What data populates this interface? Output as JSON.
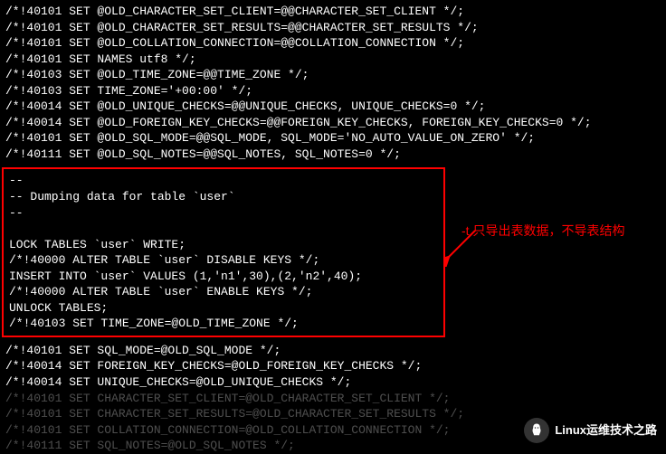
{
  "top_lines": [
    "/*!40101 SET @OLD_CHARACTER_SET_CLIENT=@@CHARACTER_SET_CLIENT */;",
    "/*!40101 SET @OLD_CHARACTER_SET_RESULTS=@@CHARACTER_SET_RESULTS */;",
    "/*!40101 SET @OLD_COLLATION_CONNECTION=@@COLLATION_CONNECTION */;",
    "/*!40101 SET NAMES utf8 */;",
    "/*!40103 SET @OLD_TIME_ZONE=@@TIME_ZONE */;",
    "/*!40103 SET TIME_ZONE='+00:00' */;",
    "/*!40014 SET @OLD_UNIQUE_CHECKS=@@UNIQUE_CHECKS, UNIQUE_CHECKS=0 */;",
    "/*!40014 SET @OLD_FOREIGN_KEY_CHECKS=@@FOREIGN_KEY_CHECKS, FOREIGN_KEY_CHECKS=0 */;",
    "/*!40101 SET @OLD_SQL_MODE=@@SQL_MODE, SQL_MODE='NO_AUTO_VALUE_ON_ZERO' */;",
    "/*!40111 SET @OLD_SQL_NOTES=@@SQL_NOTES, SQL_NOTES=0 */;"
  ],
  "highlight_lines": [
    "--",
    "-- Dumping data for table `user`",
    "--",
    "",
    "LOCK TABLES `user` WRITE;",
    "/*!40000 ALTER TABLE `user` DISABLE KEYS */;",
    "INSERT INTO `user` VALUES (1,'n1',30),(2,'n2',40);",
    "/*!40000 ALTER TABLE `user` ENABLE KEYS */;",
    "UNLOCK TABLES;",
    "/*!40103 SET TIME_ZONE=@OLD_TIME_ZONE */;"
  ],
  "bottom_lines": [
    "/*!40101 SET SQL_MODE=@OLD_SQL_MODE */;",
    "/*!40014 SET FOREIGN_KEY_CHECKS=@OLD_FOREIGN_KEY_CHECKS */;",
    "/*!40014 SET UNIQUE_CHECKS=@OLD_UNIQUE_CHECKS */;",
    "/*!40101 SET CHARACTER_SET_CLIENT=@OLD_CHARACTER_SET_CLIENT */;",
    "/*!40101 SET CHARACTER_SET_RESULTS=@OLD_CHARACTER_SET_RESULTS */;",
    "/*!40101 SET COLLATION_CONNECTION=@OLD_COLLATION_CONNECTION */;",
    "/*!40111 SET SQL_NOTES=@OLD_SQL_NOTES */;"
  ],
  "annotation_text": "-t 只导出表数据，不导表结构",
  "watermark_text": "Linux运维技术之路",
  "colors": {
    "background": "#000000",
    "text": "#ffffff",
    "highlight_border": "#ff0000",
    "annotation": "#ff0000"
  }
}
